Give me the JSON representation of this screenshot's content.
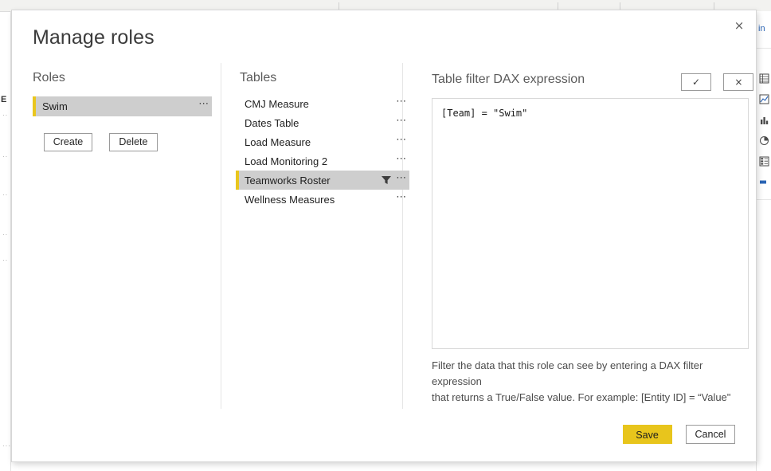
{
  "background": {
    "left_label": "E",
    "right_pane_title": "in",
    "accent_yellow": "#e9c61e",
    "ruler_ticks": [
      425,
      700,
      778,
      1075
    ]
  },
  "dialog": {
    "title": "Manage roles",
    "close_icon": "close-icon",
    "roles": {
      "heading": "Roles",
      "items": [
        {
          "label": "Swim",
          "selected": true,
          "menu": "⋯"
        }
      ],
      "create_label": "Create",
      "delete_label": "Delete"
    },
    "tables": {
      "heading": "Tables",
      "items": [
        {
          "label": "CMJ Measure",
          "selected": false,
          "has_filter": false,
          "menu": "⋯"
        },
        {
          "label": "Dates Table",
          "selected": false,
          "has_filter": false,
          "menu": "⋯"
        },
        {
          "label": "Load Measure",
          "selected": false,
          "has_filter": false,
          "menu": "⋯"
        },
        {
          "label": "Load Monitoring 2",
          "selected": false,
          "has_filter": false,
          "menu": "⋯"
        },
        {
          "label": "Teamworks Roster",
          "selected": true,
          "has_filter": true,
          "menu": "⋯"
        },
        {
          "label": "Wellness Measures",
          "selected": false,
          "has_filter": false,
          "menu": "⋯"
        }
      ]
    },
    "dax": {
      "heading": "Table filter DAX expression",
      "accept_label": "✓",
      "reject_label": "×",
      "expression": "[Team] = \"Swim\"",
      "placeholder": "",
      "help_line_1": "Filter the data that this role can see by entering a DAX filter expression",
      "help_line_2": "that returns a True/False value. For example: [Entity ID] = “Value\""
    },
    "footer": {
      "save_label": "Save",
      "cancel_label": "Cancel",
      "save_color": "#e8c51c"
    }
  }
}
